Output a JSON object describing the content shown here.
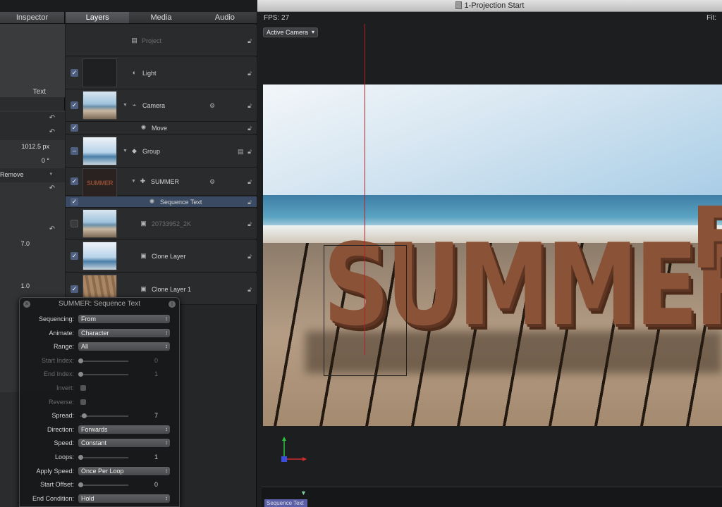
{
  "window": {
    "title": "1-Projection Start"
  },
  "inspector": {
    "title": "Inspector",
    "text_tab": "Text",
    "rows": [
      {
        "value": "",
        "revert": "↶"
      },
      {
        "value": "",
        "revert": "↶"
      },
      {
        "value": "1012.5 px",
        "revert": ""
      },
      {
        "value": "0 °",
        "revert": ""
      },
      {
        "value": "Remove",
        "revert": ""
      },
      {
        "value": "",
        "revert": "↶"
      },
      {
        "value": "",
        "revert": "↶"
      },
      {
        "value": "7.0",
        "revert": ""
      },
      {
        "value": "1.0",
        "revert": ""
      }
    ]
  },
  "layers_panel": {
    "tabs": [
      "Layers",
      "Media",
      "Audio"
    ],
    "project_label": "Project",
    "layers": [
      {
        "name": "Light",
        "checked": true,
        "thumb": "dark"
      },
      {
        "name": "Camera",
        "checked": true,
        "thumb": "beach"
      },
      {
        "name": "Move",
        "checked": true,
        "thumb": ""
      },
      {
        "name": "Group",
        "checked": "partial",
        "thumb": "sky"
      },
      {
        "name": "SUMMER",
        "checked": true,
        "thumb": "sum",
        "thumb_text": "SUMMER"
      },
      {
        "name": "Sequence Text",
        "checked": true,
        "thumb": "",
        "selected": true
      },
      {
        "name": "20733952_2K",
        "checked": false,
        "thumb": "beach"
      },
      {
        "name": "Clone Layer",
        "checked": true,
        "thumb": "sky"
      },
      {
        "name": "Clone Layer 1",
        "checked": true,
        "thumb": "wood"
      }
    ]
  },
  "hud": {
    "title": "SUMMER: Sequence Text",
    "rows": [
      {
        "label": "Sequencing:",
        "type": "popup",
        "value": "From"
      },
      {
        "label": "Animate:",
        "type": "popup",
        "value": "Character"
      },
      {
        "label": "Range:",
        "type": "popup",
        "value": "All"
      },
      {
        "label": "Start Index:",
        "type": "slider",
        "value": "0",
        "disabled": true,
        "fraction": 0
      },
      {
        "label": "End Index:",
        "type": "slider",
        "value": "1",
        "disabled": true,
        "fraction": 0
      },
      {
        "label": "Invert:",
        "type": "check",
        "disabled": true
      },
      {
        "label": "Reverse:",
        "type": "check",
        "disabled": true
      },
      {
        "label": "Spread:",
        "type": "slider",
        "value": "7",
        "fraction": 0.07
      },
      {
        "label": "Direction:",
        "type": "popup",
        "value": "Forwards"
      },
      {
        "label": "Speed:",
        "type": "popup",
        "value": "Constant"
      },
      {
        "label": "Loops:",
        "type": "slider",
        "value": "1",
        "fraction": 0
      },
      {
        "label": "Apply Speed:",
        "type": "popup",
        "value": "Once Per Loop"
      },
      {
        "label": "Start Offset:",
        "type": "slider",
        "value": "0",
        "fraction": 0
      },
      {
        "label": "End Condition:",
        "type": "popup",
        "value": "Hold"
      }
    ]
  },
  "canvas": {
    "fps": "FPS: 27",
    "fit": "Fit:",
    "camera_menu": "Active Camera",
    "scene_text": "SUMMER",
    "scene_text_rear": "F"
  },
  "timeline": {
    "clip_label": "Sequence Text"
  }
}
